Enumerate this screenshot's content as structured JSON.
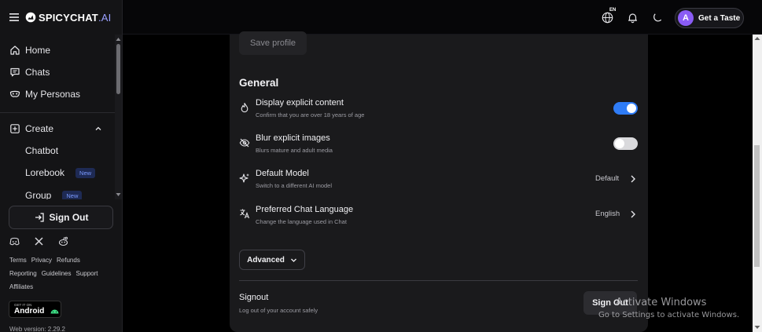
{
  "brand": {
    "name": "SPICYCHAT",
    "suffix": ".AI"
  },
  "sidebar": {
    "nav": [
      {
        "label": "Home",
        "icon": "home-icon"
      },
      {
        "label": "Chats",
        "icon": "chat-icon"
      },
      {
        "label": "My Personas",
        "icon": "mask-icon"
      }
    ],
    "create_label": "Create",
    "create_items": [
      {
        "label": "Chatbot",
        "badge": ""
      },
      {
        "label": "Lorebook",
        "badge": "New"
      },
      {
        "label": "Group",
        "badge": "New"
      }
    ],
    "signout_label": "Sign Out",
    "links_row1": [
      "Terms",
      "Privacy",
      "Refunds"
    ],
    "links_row2": [
      "Reporting",
      "Guidelines",
      "Support"
    ],
    "links_row3": [
      "Affiliates"
    ],
    "android_small": "GET IT ON",
    "android_label": "Android",
    "web_version": "Web version: 2.29.2"
  },
  "topbar": {
    "language_tag": "EN",
    "avatar_letter": "A",
    "cta_label": "Get a Taste"
  },
  "panel": {
    "save_profile_label": "Save profile",
    "general_title": "General",
    "rows": [
      {
        "title": "Display explicit content",
        "subtitle": "Confirm that you are over 18 years of age",
        "type": "toggle",
        "on": true
      },
      {
        "title": "Blur explicit images",
        "subtitle": "Blurs mature and adult media",
        "type": "toggle",
        "on": false
      },
      {
        "title": "Default Model",
        "subtitle": "Switch to a different AI model",
        "type": "select",
        "value": "Default"
      },
      {
        "title": "Preferred Chat Language",
        "subtitle": "Change the language used in Chat",
        "type": "select",
        "value": "English"
      }
    ],
    "advanced_label": "Advanced",
    "signout_title": "Signout",
    "signout_subtitle": "Log out of your account safely",
    "signout_button": "Sign Out"
  },
  "watermark": {
    "line1": "Activate Windows",
    "line2": "Go to Settings to activate Windows."
  },
  "colors": {
    "accent": "#2f7cf6",
    "toggle_off": "#d9d9dc",
    "avatar": "#8a5cf5",
    "badge_text": "#7b9bff"
  }
}
